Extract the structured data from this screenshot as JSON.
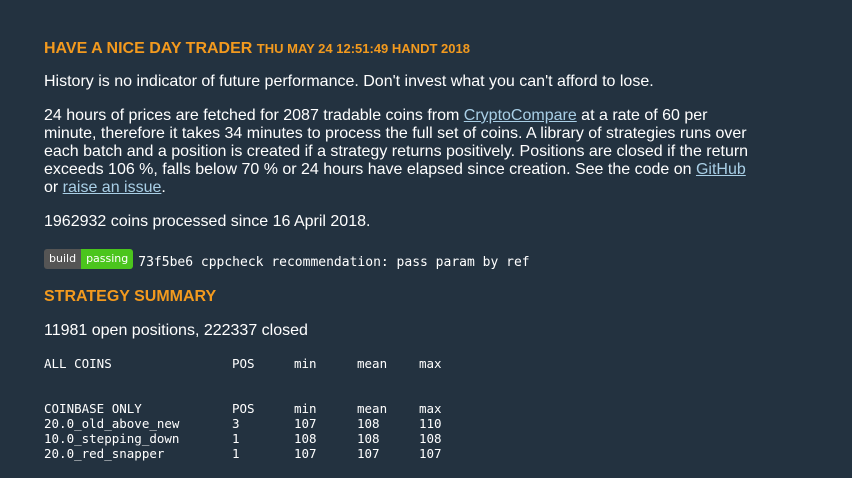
{
  "header": {
    "title": "HAVE A NICE DAY TRADER",
    "date": "THU MAY 24 12:51:49 HANDT 2018"
  },
  "disclaimer": "History is no indicator of future performance. Don't invest what you can't afford to lose.",
  "description": {
    "part1": "24 hours of prices are fetched for 2087 tradable coins from ",
    "link_cryptocompare": "CryptoCompare",
    "part2": " at a rate of 60 per minute, therefore it takes 34 minutes to process the full set of coins. A library of strategies runs over each batch and a position is created if a strategy returns positively. Positions are closed if the return exceeds 106 %, falls below 70 % or 24 hours have elapsed since creation. See the code on ",
    "link_github": "GitHub",
    "part3": " or ",
    "link_issue": "raise an issue",
    "part4": "."
  },
  "processed": "1962932 coins processed since 16 April 2018.",
  "build": {
    "badge_left": "build",
    "badge_right": "passing",
    "commit": "73f5be6 cppcheck recommendation: pass param by ref",
    "badge_color": "#4bc51d"
  },
  "strategy": {
    "heading": "STRATEGY SUMMARY",
    "positions": "11981 open positions, 222337 closed",
    "all_coins": {
      "headers": [
        "ALL COINS",
        "POS",
        "min",
        "mean",
        "max"
      ]
    },
    "coinbase_only": {
      "headers": [
        "COINBASE ONLY",
        "POS",
        "min",
        "mean",
        "max"
      ],
      "rows": [
        [
          "20.0_old_above_new",
          "3",
          "107",
          "108",
          "110"
        ],
        [
          "10.0_stepping_down",
          "1",
          "108",
          "108",
          "108"
        ],
        [
          "20.0_red_snapper",
          "1",
          "107",
          "107",
          "107"
        ]
      ]
    }
  },
  "colors": {
    "background": "#233240",
    "accent": "#f39a1e",
    "link": "#a9cfe6"
  }
}
